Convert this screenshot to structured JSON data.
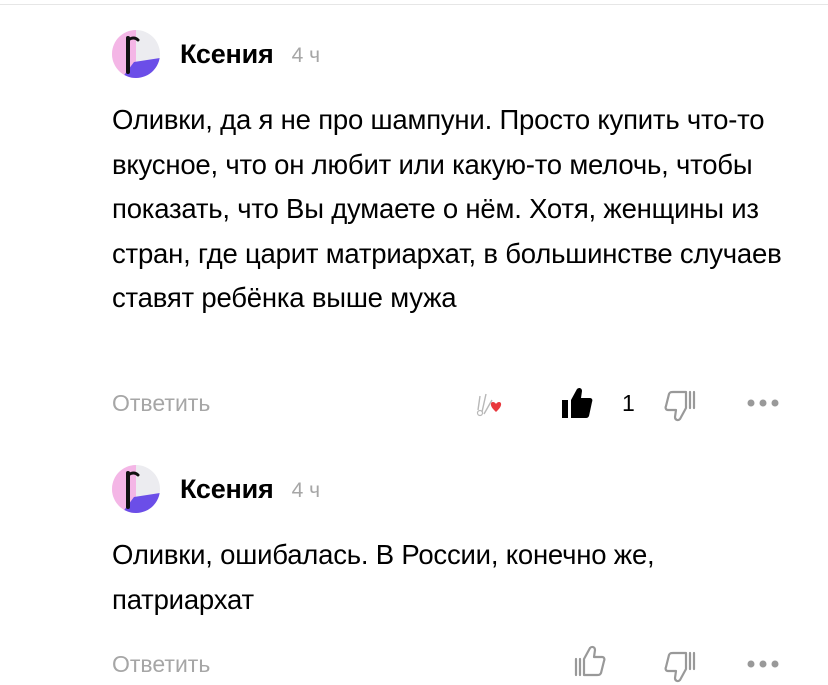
{
  "comments": [
    {
      "author": "Ксения",
      "time": "4 ч",
      "text": "Оливки, да я не про шампуни. Просто купить что-то вкусное, что он любит или какую-то мелочь, чтобы показать, что Вы думаете о нём. Хотя, женщины из стран, где царит матриархат, в большинстве случаев ставят ребёнка выше мужа",
      "reply_label": "Ответить",
      "like_count": "1",
      "liked": true
    },
    {
      "author": "Ксения",
      "time": "4 ч",
      "text": "Оливки, ошибалась. В России, конечно же, патриархат",
      "reply_label": "Ответить",
      "liked": false
    }
  ],
  "colors": {
    "text": "#000000",
    "muted": "#a6a6a6",
    "avatar_pink": "#f4b6e6",
    "avatar_purple": "#6b4ee8",
    "avatar_gray": "#ececf0",
    "heart": "#e8383d"
  },
  "icons": [
    "avatar",
    "reaction-heart-icon",
    "like-icon",
    "dislike-icon",
    "more-icon"
  ]
}
